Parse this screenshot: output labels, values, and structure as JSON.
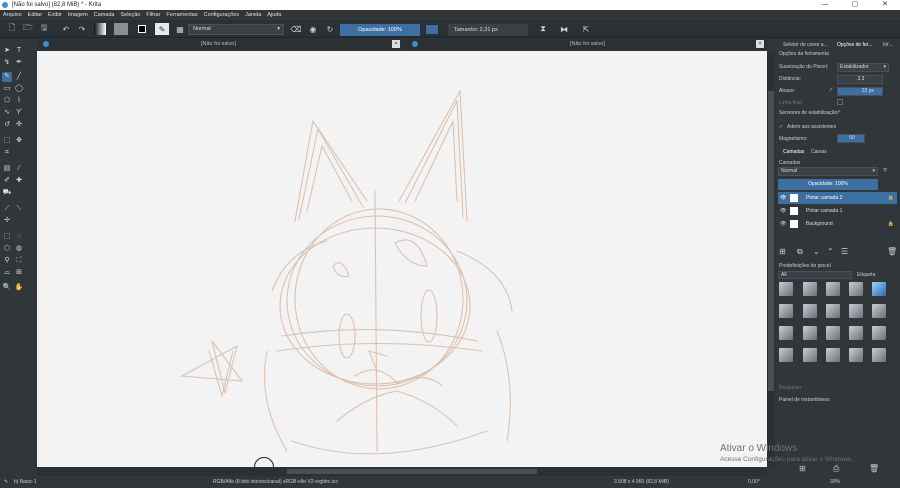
{
  "window": {
    "title": "[Não foi salvo] (82,8 MiB) * - Krita",
    "controls": [
      "—",
      "▢",
      "✕"
    ]
  },
  "menu": [
    "Arquivo",
    "Editar",
    "Exibir",
    "Imagem",
    "Camada",
    "Seleção",
    "Filtrar",
    "Ferramentas",
    "Configurações",
    "Janela",
    "Ajuda"
  ],
  "toolbar": {
    "blend_mode": "Normal",
    "opacity_label": "Opacidade: 100%",
    "size_label": "Tamanho: 2,31 px"
  },
  "document_tabs": [
    {
      "label": "[Não foi salvo]"
    },
    {
      "label": "[Não foi salvo]"
    }
  ],
  "dock": {
    "top_tabs": [
      "Seletor de cores a...",
      "Opções de fer...",
      "Inf..."
    ],
    "tool_options_title": "Opções da ferramenta",
    "smoothing_label": "Suavização do Pincel:",
    "smoothing_value": "Estabilizador",
    "distance_label": "Distância:",
    "distance_value": "3,3",
    "delay_label": "Atraso:",
    "delay_value": "22 px",
    "finish_label": "Linha final",
    "sensors_label": "Sensores de estabilização:",
    "snap_label": "Aderir aos assistentes",
    "magnetism_label": "Magnetismo:",
    "magnetism_value": "50",
    "layer_tabs": [
      "Camadas",
      "Canais"
    ],
    "layers_title": "Camadas",
    "layer_blend": "Normal",
    "layer_opacity": "Opacidade: 100%",
    "layers": [
      {
        "name": "Pintar camada 2",
        "selected": true
      },
      {
        "name": "Pintar camada 1",
        "selected": false
      },
      {
        "name": "Background",
        "selected": false
      }
    ],
    "presets_title": "Predefinições do pincel",
    "presets_filter": "All",
    "presets_tag": "Etiqueta",
    "search_placeholder": "Pesquisar",
    "history_title": "Painel de instantâneos"
  },
  "status": {
    "brush": "b) Basic-1",
    "color_space": "RGB/Alfa (8-bits inteiros/canal)  sRGB-elle-V2-srgbtrc.icc",
    "dimensions": "3.508 x 4.960 (82,8 MiB)",
    "zoom": "30%",
    "rotation": "0,00°"
  },
  "watermark": {
    "line1": "Ativar o Windows",
    "line2": "Acesse Configurações para ativar o Windows."
  },
  "colors": {
    "accent": "#3d6fa3",
    "panel": "#31363b",
    "canvas": "#f3f3f3",
    "sketch": "#d9b9a5"
  }
}
